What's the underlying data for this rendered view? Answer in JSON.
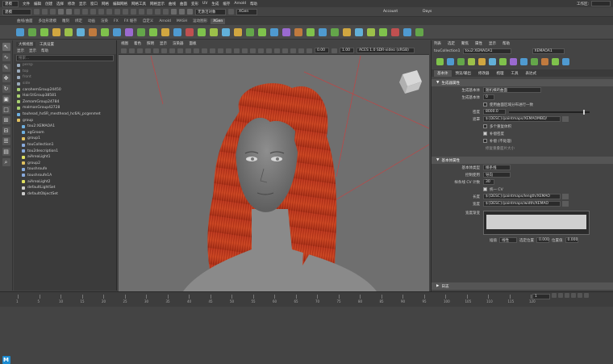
{
  "menubar": {
    "items": [
      "文件",
      "编辑",
      "创建",
      "选择",
      "修改",
      "显示",
      "窗口",
      "网格",
      "编辑网格",
      "网格工具",
      "网格显示",
      "曲线",
      "曲面",
      "变形",
      "UV",
      "生成",
      "缓存",
      "Arnold",
      "帮助"
    ],
    "mode": "建模",
    "render_label": "XGen",
    "lang_field": "无激活对象",
    "account_label": "Account",
    "days_label": "Days",
    "workspace_label": "工作区:"
  },
  "shelf": {
    "tabs": [
      "曲线/曲面",
      "多边形建模",
      "雕刻",
      "绑定",
      "动画",
      "渲染",
      "FX",
      "FX 缓存",
      "自定义",
      "Arnold",
      "MASH",
      "运动图形",
      "XGen"
    ],
    "active_tab": "XGen"
  },
  "outliner": {
    "tabs": [
      "大纲视图",
      "工具设置"
    ],
    "menu": [
      "显示",
      "显示",
      "帮助"
    ],
    "search_placeholder": "搜索...",
    "items": [
      {
        "label": "persp",
        "dim": true
      },
      {
        "label": "top",
        "dim": true
      },
      {
        "label": "front",
        "dim": true
      },
      {
        "label": "side",
        "dim": true
      },
      {
        "label": "carohemGroup24450",
        "dim": false
      },
      {
        "label": "Hair1tGroup38581",
        "dim": false
      },
      {
        "label": "ZemamGroup24784",
        "dim": false
      },
      {
        "label": "malmanGroup42728",
        "dim": false
      },
      {
        "label": "touhead_hc6R_mesthead_hc6Ai_pcgenmet",
        "dim": false
      },
      {
        "label": "group",
        "dim": false
      },
      {
        "label": "tou2:XEMAOA1",
        "dim": false
      },
      {
        "label": "xgGroom",
        "dim": false
      },
      {
        "label": "group1",
        "dim": false
      },
      {
        "label": "touCollection1",
        "dim": false
      },
      {
        "label": "tou2description1",
        "dim": false
      },
      {
        "label": "aiAreaLight1",
        "dim": false
      },
      {
        "label": "group2",
        "dim": false
      },
      {
        "label": "toushroufe",
        "dim": false
      },
      {
        "label": "toushroufe1A",
        "dim": false
      },
      {
        "label": "aiAreaLight2",
        "dim": false
      },
      {
        "label": "defaultLightSet",
        "dim": false
      },
      {
        "label": "defaultObjectSet",
        "dim": false
      }
    ]
  },
  "viewport": {
    "menu": [
      "视图",
      "着色",
      "照明",
      "显示",
      "渲染器",
      "面板"
    ],
    "field1": "0.00",
    "field2": "1.00",
    "colorspace": "ACES 1.0 SDR-video (sRGB)",
    "cube_label": "FRONT"
  },
  "attribute_editor": {
    "menu": [
      "列表",
      "选定",
      "聚焦",
      "属性",
      "显示",
      "帮助"
    ],
    "node_label": "touCollection1",
    "node_field": "tou2:XEMAOA1",
    "node_field2": "XEMAOA1",
    "tabs": [
      "基本体",
      "预览/输出",
      "修改器",
      "梳理",
      "工具",
      "表达式"
    ],
    "section_generate": "生成器属性",
    "gen_mode_label": "生成基本体",
    "gen_mode_value": "随机横跨曲面",
    "count_label": "生成基本体",
    "count_value": "0",
    "chk_uniform": "使用曲面区域分布进行一致",
    "density_label": "密度",
    "density_value": "8000.0",
    "mask_label": "遮罩",
    "mask_value": "${DESC}/paintmaps/XEMAOMBD/",
    "chk_multi": "多个重复体积",
    "chk_cutoff": "补偿密度",
    "chk_group": "补偿 (不处理)",
    "btn_repair": "修复重叠面片大小",
    "section_attrs": "基本体属性",
    "prim_type_label": "基本体类型",
    "prim_type_value": "样条线",
    "control_label": "控制使用",
    "control_value": "导向",
    "cv_label": "样条线 CV 计数",
    "cv_value": "30",
    "chk_cv": "统一 CV",
    "length_label": "长度",
    "length_value": "${DESC}/paintmaps/length/XEMAO",
    "width_label": "宽度",
    "width_value": "${DESC}/paintmaps/width/XEMAO",
    "ramp_label": "宽度渐变",
    "interp_label": "插值",
    "interp_value": "线性",
    "pos_label": "选定位置",
    "pos_value": "0.000",
    "val_label": "位置值",
    "val_value": "0.000",
    "log_label": "日志"
  },
  "timeline": {
    "ticks": [
      "1",
      "5",
      "10",
      "15",
      "20",
      "25",
      "30",
      "35",
      "40",
      "45",
      "50",
      "55",
      "60",
      "65",
      "70",
      "75",
      "80",
      "85",
      "90",
      "95",
      "100",
      "105",
      "110",
      "115",
      "120"
    ],
    "current": "1"
  },
  "colors": {
    "hair": "#c8361c",
    "accent": "#5ba3d6",
    "maya_logo": "#1a8ad0"
  }
}
